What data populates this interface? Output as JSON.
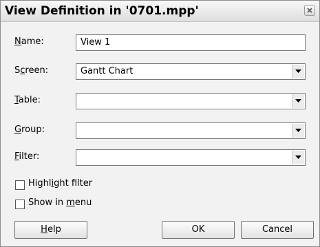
{
  "dialog": {
    "title": "View Definition in '0701.mpp'",
    "close_icon": "close-icon"
  },
  "form": {
    "name": {
      "label_pre": "",
      "label_key": "N",
      "label_post": "ame:",
      "value": "View 1"
    },
    "screen": {
      "label_pre": "S",
      "label_key": "c",
      "label_post": "reen:",
      "value": "Gantt Chart"
    },
    "table": {
      "label_pre": "",
      "label_key": "T",
      "label_post": "able:",
      "value": ""
    },
    "group": {
      "label_pre": "",
      "label_key": "G",
      "label_post": "roup:",
      "value": ""
    },
    "filter": {
      "label_pre": "",
      "label_key": "F",
      "label_post": "ilter:",
      "value": ""
    }
  },
  "options": {
    "highlight_filter": {
      "label_pre": "Highl",
      "label_key": "i",
      "label_post": "ght filter",
      "checked": false
    },
    "show_in_menu": {
      "label_pre": "Show in ",
      "label_key": "m",
      "label_post": "enu",
      "checked": false
    }
  },
  "buttons": {
    "help": {
      "label_pre": "",
      "label_key": "H",
      "label_post": "elp"
    },
    "ok": {
      "label": "OK"
    },
    "cancel": {
      "label": "Cancel"
    }
  },
  "icons": {
    "dropdown": "chevron-down-icon"
  }
}
